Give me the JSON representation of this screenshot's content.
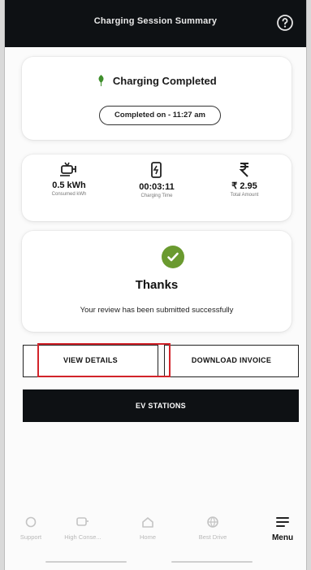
{
  "header": {
    "title": "Charging Session Summary",
    "help_icon": "help-circle-icon"
  },
  "status": {
    "text": "Charging Completed",
    "completed_on": "Completed on - 11:27 am",
    "status_color": "#3f8f2c"
  },
  "stats": [
    {
      "icon": "ev-plug-icon",
      "value": "0.5 kWh",
      "label": "Consumed kWh"
    },
    {
      "icon": "charging-timer-icon",
      "value": "00:03:11",
      "label": "Charging Time"
    },
    {
      "icon": "rupee-icon",
      "value": "₹ 2.95",
      "label": "Total Amount"
    }
  ],
  "review": {
    "title": "Thanks",
    "message": "Your review has been submitted successfully",
    "check_color": "#6a9a2f"
  },
  "buttons": {
    "view_details": "VIEW DETAILS",
    "download_invoice": "DOWNLOAD INVOICE",
    "ev_stations": "EV STATIONS"
  },
  "bottom_nav": [
    {
      "icon": "support-icon",
      "label": "Support"
    },
    {
      "icon": "ev-charger-icon",
      "label": "High Conse..."
    },
    {
      "icon": "home-icon",
      "label": "Home"
    },
    {
      "icon": "globe-icon",
      "label": "Best Drive"
    },
    {
      "icon": "menu-icon",
      "label": "Menu",
      "active": true
    }
  ],
  "colors": {
    "header_bg": "#0e1114",
    "highlight": "#d2232a"
  }
}
